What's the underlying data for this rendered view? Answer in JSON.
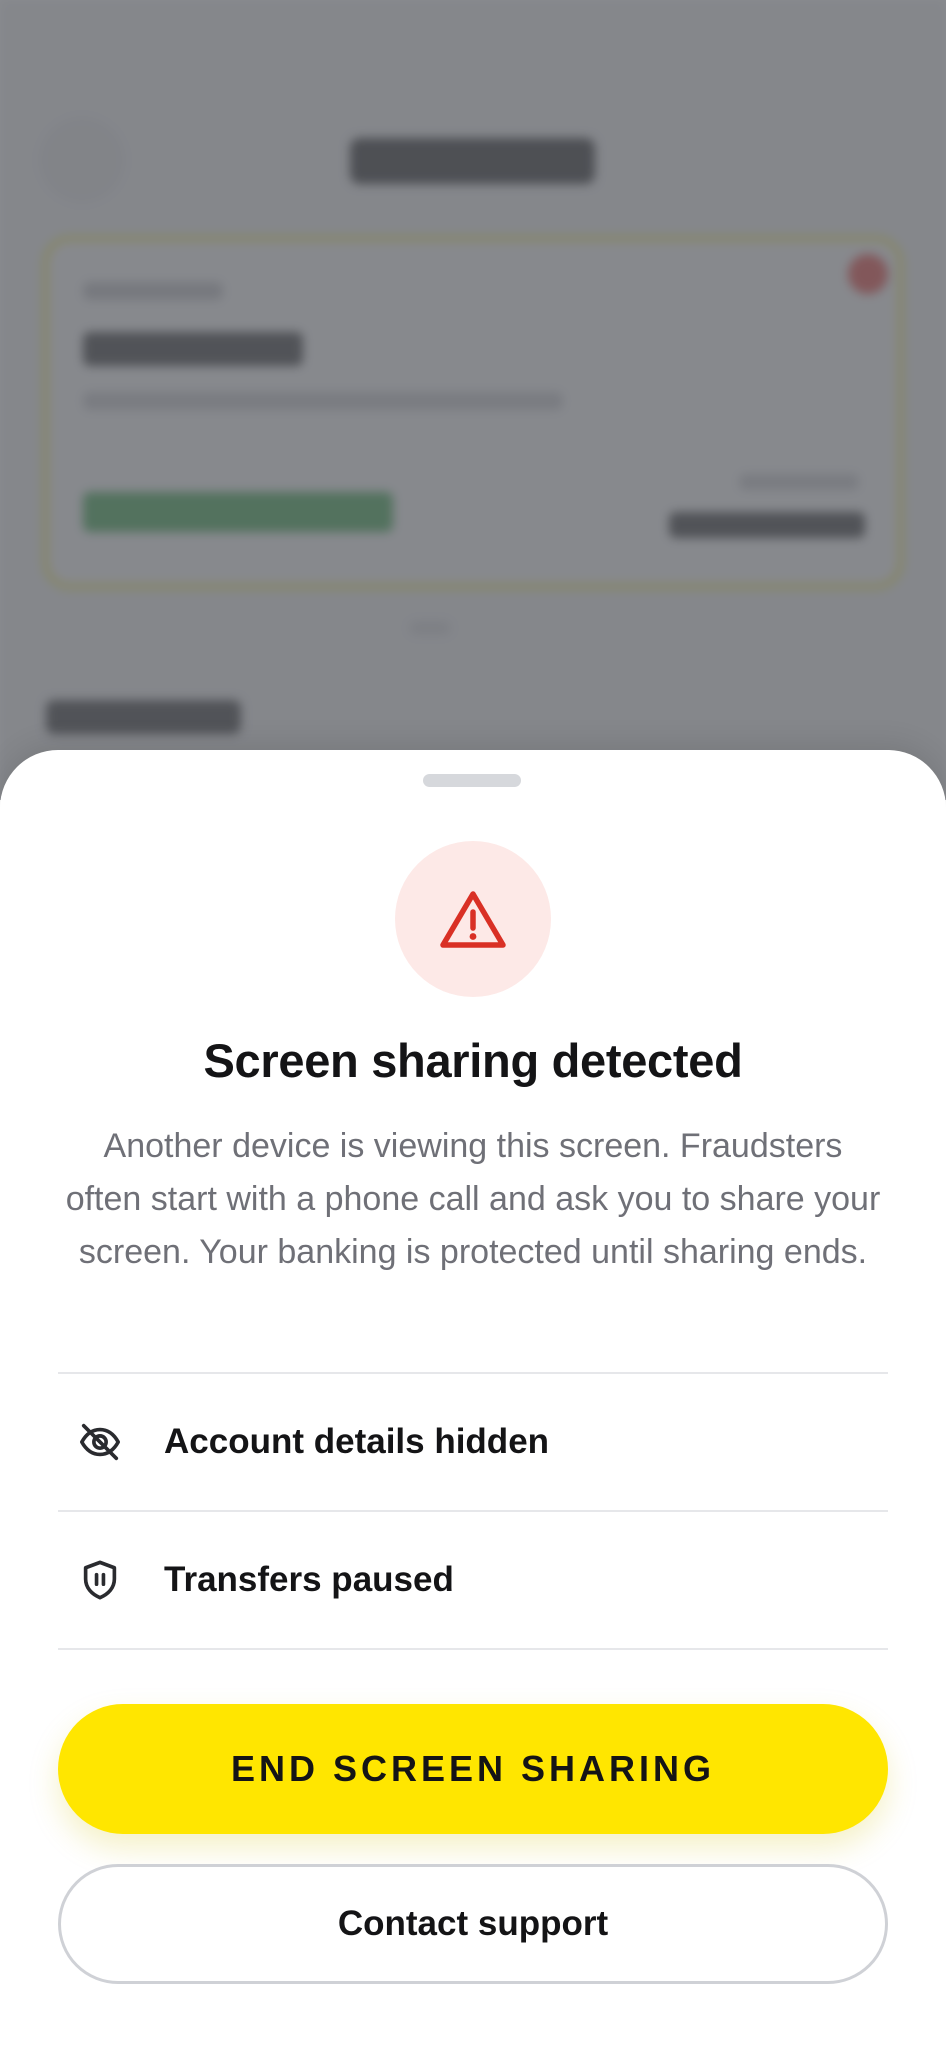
{
  "sheet": {
    "title": "Screen sharing detected",
    "description": "Another device is viewing this screen. Fraudsters often start with a phone call and ask you to share your screen. Your banking is protected until sharing ends.",
    "alert_icon": "warning-triangle-icon",
    "status_items": [
      {
        "icon": "eye-off-icon",
        "label": "Account details hidden"
      },
      {
        "icon": "shield-pause-icon",
        "label": "Transfers paused"
      }
    ],
    "primary_action": "END SCREEN SHARING",
    "secondary_action": "Contact support"
  },
  "colors": {
    "accent": "#FFE600",
    "alert": "#D93025",
    "alert_background": "#FDE9E7",
    "text_primary": "#141416",
    "text_secondary": "#6F7077"
  }
}
